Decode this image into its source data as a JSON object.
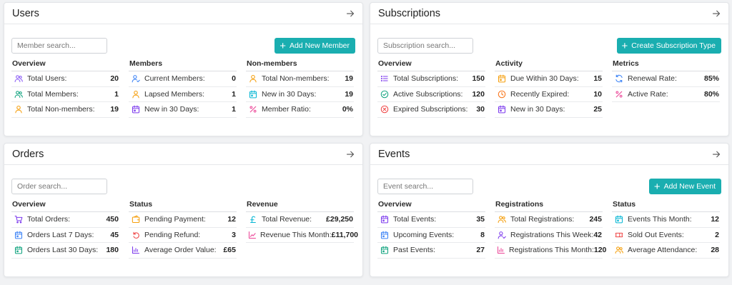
{
  "cards": {
    "users": {
      "title": "Users",
      "search_placeholder": "Member search...",
      "button": "Add New Member",
      "cols": [
        {
          "head": "Overview",
          "rows": [
            {
              "label": "Total Users:",
              "value": "20",
              "icon": "users-icon",
              "color": "#8b5cf6"
            },
            {
              "label": "Total Members:",
              "value": "1",
              "icon": "users-icon",
              "color": "#10a37f"
            },
            {
              "label": "Total Non-members:",
              "value": "19",
              "icon": "user-icon",
              "color": "#f59e0b"
            }
          ]
        },
        {
          "head": "Members",
          "rows": [
            {
              "label": "Current Members:",
              "value": "0",
              "icon": "user-check-icon",
              "color": "#3b82f6"
            },
            {
              "label": "Lapsed Members:",
              "value": "1",
              "icon": "user-icon",
              "color": "#f59e0b"
            },
            {
              "label": "New in 30 Days:",
              "value": "1",
              "icon": "calendar-icon",
              "color": "#7c3aed"
            }
          ]
        },
        {
          "head": "Non-members",
          "rows": [
            {
              "label": "Total Non-members:",
              "value": "19",
              "icon": "user-icon",
              "color": "#f59e0b"
            },
            {
              "label": "New in 30 Days:",
              "value": "19",
              "icon": "calendar-icon",
              "color": "#06b6d4"
            },
            {
              "label": "Member Ratio:",
              "value": "0%",
              "icon": "percent-icon",
              "color": "#ec4899"
            }
          ]
        }
      ]
    },
    "subscriptions": {
      "title": "Subscriptions",
      "search_placeholder": "Subscription search...",
      "button": "Create Subscription Type",
      "cols": [
        {
          "head": "Overview",
          "rows": [
            {
              "label": "Total Subscriptions:",
              "value": "150",
              "icon": "list-icon",
              "color": "#7c3aed"
            },
            {
              "label": "Active Subscriptions:",
              "value": "120",
              "icon": "check-circle-icon",
              "color": "#10a37f"
            },
            {
              "label": "Expired Subscriptions:",
              "value": "30",
              "icon": "x-circle-icon",
              "color": "#ef4444"
            }
          ]
        },
        {
          "head": "Activity",
          "rows": [
            {
              "label": "Due Within 30 Days:",
              "value": "15",
              "icon": "calendar-icon",
              "color": "#f59e0b"
            },
            {
              "label": "Recently Expired:",
              "value": "10",
              "icon": "clock-icon",
              "color": "#f97316"
            },
            {
              "label": "New in 30 Days:",
              "value": "25",
              "icon": "calendar-icon",
              "color": "#7c3aed"
            }
          ]
        },
        {
          "head": "Metrics",
          "rows": [
            {
              "label": "Renewal Rate:",
              "value": "85%",
              "icon": "refresh-icon",
              "color": "#3b82f6"
            },
            {
              "label": "Active Rate:",
              "value": "80%",
              "icon": "percent-icon",
              "color": "#ec4899"
            }
          ]
        }
      ]
    },
    "orders": {
      "title": "Orders",
      "search_placeholder": "Order search...",
      "cols": [
        {
          "head": "Overview",
          "rows": [
            {
              "label": "Total Orders:",
              "value": "450",
              "icon": "cart-icon",
              "color": "#7c3aed"
            },
            {
              "label": "Orders Last 7 Days:",
              "value": "45",
              "icon": "calendar-icon",
              "color": "#3b82f6"
            },
            {
              "label": "Orders Last 30 Days:",
              "value": "180",
              "icon": "calendar-icon",
              "color": "#10a37f"
            }
          ]
        },
        {
          "head": "Status",
          "rows": [
            {
              "label": "Pending Payment:",
              "value": "12",
              "icon": "wallet-icon",
              "color": "#f59e0b"
            },
            {
              "label": "Pending Refund:",
              "value": "3",
              "icon": "undo-icon",
              "color": "#ef4444"
            },
            {
              "label": "Average Order Value:",
              "value": "£65",
              "icon": "bar-chart-icon",
              "color": "#7c3aed"
            }
          ]
        },
        {
          "head": "Revenue",
          "rows": [
            {
              "label": "Total Revenue:",
              "value": "£29,250",
              "icon": "pound-icon",
              "color": "#06b6d4"
            },
            {
              "label": "Revenue This Month:",
              "value": "£11,700",
              "icon": "trend-icon",
              "color": "#ec4899"
            }
          ]
        }
      ]
    },
    "events": {
      "title": "Events",
      "search_placeholder": "Event search...",
      "button": "Add New Event",
      "cols": [
        {
          "head": "Overview",
          "rows": [
            {
              "label": "Total Events:",
              "value": "35",
              "icon": "calendar-icon",
              "color": "#7c3aed"
            },
            {
              "label": "Upcoming Events:",
              "value": "8",
              "icon": "calendar-icon",
              "color": "#3b82f6"
            },
            {
              "label": "Past Events:",
              "value": "27",
              "icon": "calendar-icon",
              "color": "#10a37f"
            }
          ]
        },
        {
          "head": "Registrations",
          "rows": [
            {
              "label": "Total Registrations:",
              "value": "245",
              "icon": "users-icon",
              "color": "#f59e0b"
            },
            {
              "label": "Registrations This Week:",
              "value": "42",
              "icon": "user-check-icon",
              "color": "#7c3aed"
            },
            {
              "label": "Registrations This Month:",
              "value": "120",
              "icon": "bar-chart-icon",
              "color": "#ec4899"
            }
          ]
        },
        {
          "head": "Status",
          "rows": [
            {
              "label": "Events This Month:",
              "value": "12",
              "icon": "calendar-icon",
              "color": "#06b6d4"
            },
            {
              "label": "Sold Out Events:",
              "value": "2",
              "icon": "ticket-icon",
              "color": "#ef4444"
            },
            {
              "label": "Average Attendance:",
              "value": "28",
              "icon": "users-icon",
              "color": "#f59e0b"
            }
          ]
        }
      ]
    }
  }
}
